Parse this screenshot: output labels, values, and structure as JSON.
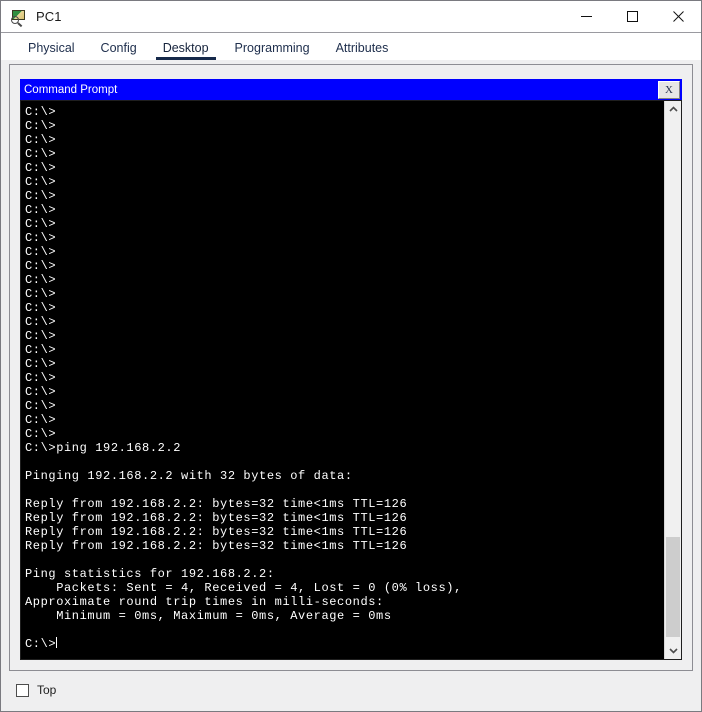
{
  "window": {
    "title": "PC1",
    "icon": "packet-tracer-pc-icon",
    "controls": {
      "minimize": "—",
      "maximize": "□",
      "close": "✕"
    }
  },
  "tabs": [
    {
      "label": "Physical",
      "active": false
    },
    {
      "label": "Config",
      "active": false
    },
    {
      "label": "Desktop",
      "active": true
    },
    {
      "label": "Programming",
      "active": false
    },
    {
      "label": "Attributes",
      "active": false
    }
  ],
  "command_prompt": {
    "title": "Command Prompt",
    "close_label": "X",
    "titlebar_color": "#0000FF",
    "background_color": "#000000",
    "text_color": "#FFFFFF",
    "lines": [
      "C:\\>",
      "C:\\>",
      "C:\\>",
      "C:\\>",
      "C:\\>",
      "C:\\>",
      "C:\\>",
      "C:\\>",
      "C:\\>",
      "C:\\>",
      "C:\\>",
      "C:\\>",
      "C:\\>",
      "C:\\>",
      "C:\\>",
      "C:\\>",
      "C:\\>",
      "C:\\>",
      "C:\\>",
      "C:\\>",
      "C:\\>",
      "C:\\>",
      "C:\\>",
      "C:\\>",
      "C:\\>ping 192.168.2.2",
      "",
      "Pinging 192.168.2.2 with 32 bytes of data:",
      "",
      "Reply from 192.168.2.2: bytes=32 time<1ms TTL=126",
      "Reply from 192.168.2.2: bytes=32 time<1ms TTL=126",
      "Reply from 192.168.2.2: bytes=32 time<1ms TTL=126",
      "Reply from 192.168.2.2: bytes=32 time<1ms TTL=126",
      "",
      "Ping statistics for 192.168.2.2:",
      "    Packets: Sent = 4, Received = 4, Lost = 0 (0% loss),",
      "Approximate round trip times in milli-seconds:",
      "    Minimum = 0ms, Maximum = 0ms, Average = 0ms",
      ""
    ],
    "prompt": "C:\\>",
    "scrollbar": {
      "up_arrow": "▲",
      "down_arrow": "▼",
      "thumb_top_pct": 80,
      "thumb_height_pct": 19
    }
  },
  "footer": {
    "top_checkbox_label": "Top",
    "top_checkbox_checked": false
  }
}
